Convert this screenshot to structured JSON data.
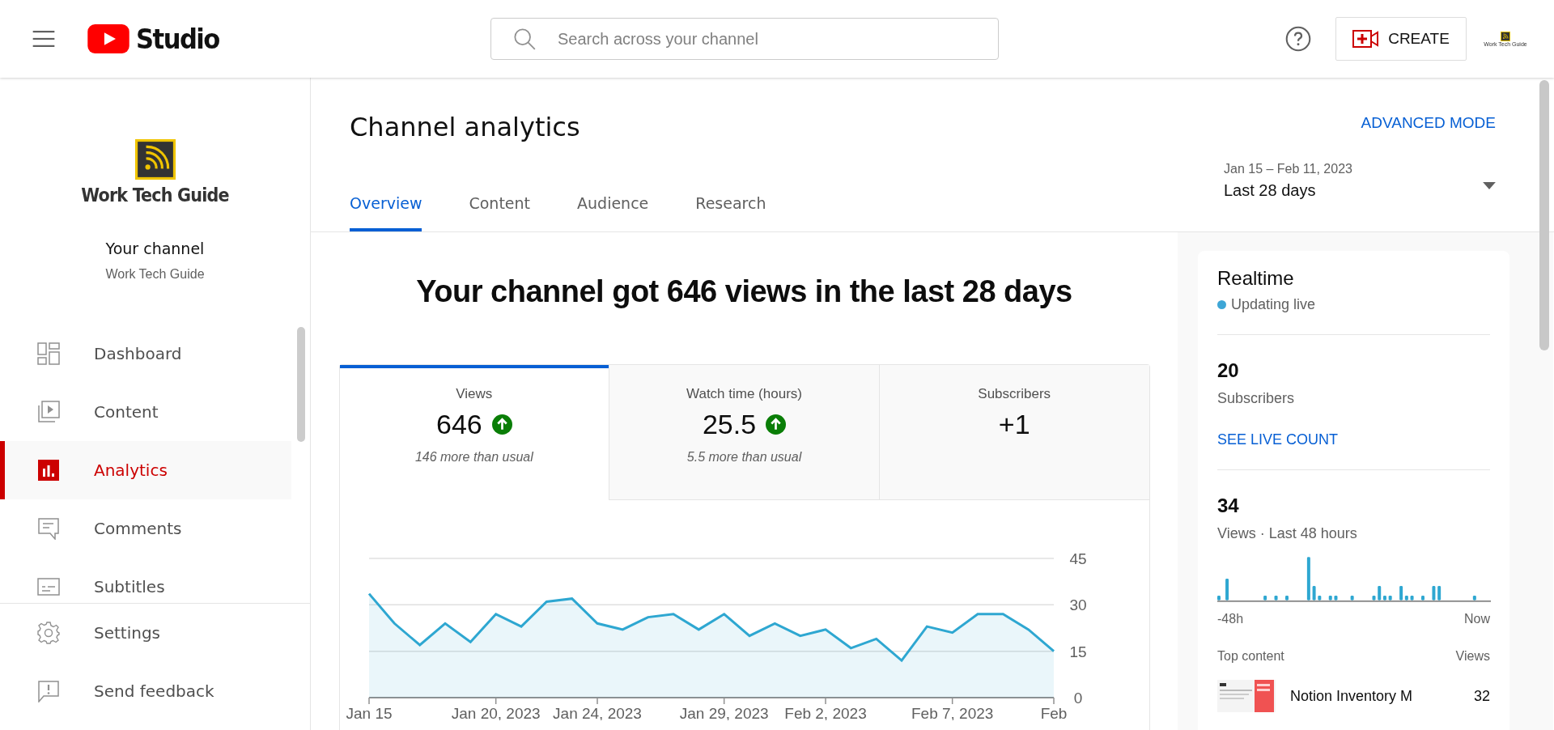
{
  "header": {
    "brand": "Studio",
    "search": {
      "placeholder": "Search across your channel"
    },
    "create_button": "CREATE",
    "avatar_text": "Work Tech Guide"
  },
  "sidebar": {
    "logo_text": "Work Tech Guide",
    "channel_label": "Your channel",
    "channel_name": "Work Tech Guide",
    "items": [
      {
        "label": "Dashboard",
        "kind": "dashboard",
        "selected": false
      },
      {
        "label": "Content",
        "kind": "content",
        "selected": false
      },
      {
        "label": "Analytics",
        "kind": "analytics",
        "selected": true
      },
      {
        "label": "Comments",
        "kind": "comments",
        "selected": false
      },
      {
        "label": "Subtitles",
        "kind": "subtitles",
        "selected": false
      }
    ],
    "footer_items": [
      {
        "label": "Settings",
        "kind": "settings"
      },
      {
        "label": "Send feedback",
        "kind": "feedback"
      }
    ]
  },
  "page": {
    "title": "Channel analytics",
    "advanced_mode": "ADVANCED MODE",
    "tabs": [
      {
        "label": "Overview",
        "selected": true
      },
      {
        "label": "Content",
        "selected": false
      },
      {
        "label": "Audience",
        "selected": false
      },
      {
        "label": "Research",
        "selected": false
      }
    ],
    "date_range": {
      "dates": "Jan 15 – Feb 11, 2023",
      "label": "Last 28 days"
    }
  },
  "overview": {
    "headline": "Your channel got 646 views in the last 28 days",
    "metrics": [
      {
        "label": "Views",
        "value": "646",
        "rising": true,
        "note": "146 more than usual",
        "selected": true
      },
      {
        "label": "Watch time (hours)",
        "value": "25.5",
        "rising": true,
        "note": "5.5 more than usual",
        "selected": false
      },
      {
        "label": "Subscribers",
        "value": "+1",
        "rising": false,
        "selected": false
      }
    ],
    "chart_data": {
      "type": "area",
      "ylim": [
        0,
        45
      ],
      "yticks": [
        0,
        15,
        30,
        45
      ],
      "categories": [
        "Jan 15",
        null,
        null,
        null,
        null,
        "Jan 20, 2023",
        null,
        null,
        null,
        "Jan 24, 2023",
        null,
        null,
        null,
        null,
        "Jan 29, 2023",
        null,
        null,
        null,
        "Feb 2, 2023",
        null,
        null,
        null,
        null,
        "Feb 7, 2023",
        null,
        null,
        null,
        "Feb"
      ],
      "series": [
        {
          "color": "#2ea7d1",
          "values": [
            33.6,
            24,
            17,
            24,
            18,
            27,
            23,
            31,
            32,
            24,
            22,
            26,
            27,
            22,
            27,
            20,
            24,
            20,
            22,
            16,
            19,
            12,
            23,
            21,
            27,
            27,
            22,
            15
          ]
        }
      ]
    }
  },
  "realtime": {
    "title": "Realtime",
    "status": "Updating live",
    "subscribers": "20",
    "subscribers_label": "Subscribers",
    "live_count_link": "SEE LIVE COUNT",
    "views": "34",
    "views_label": "Views · Last 48 hours",
    "axis_start": "-48h",
    "axis_end": "Now",
    "top_content_label": "Top content",
    "top_views_label": "Views",
    "top_content": [
      {
        "title": "Notion Inventory M",
        "views": "32"
      }
    ]
  }
}
